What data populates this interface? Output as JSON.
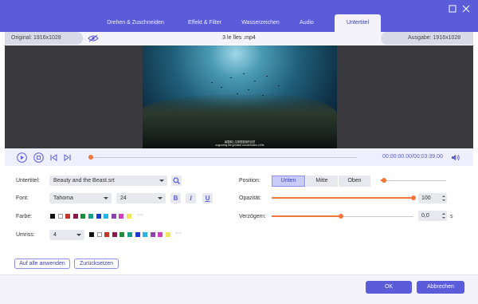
{
  "tabs": [
    "Drehen & Zuschneiden",
    "Effekt & Filter",
    "Wasserzeichen",
    "Audio",
    "Untertitel"
  ],
  "active_tab": "Untertitel",
  "info": {
    "original": "Original: 1916x1028",
    "filename": "3 le îles .mp4",
    "output": "Ausgabe: 1916x1028"
  },
  "video": {
    "subtitle_line1": "暴雪脚上生物很震撼的自然",
    "subtitle_line2": "supporting the greatest concentration of life"
  },
  "player": {
    "time": "00:00:00.00/00:03:39.00",
    "progress": 0.0
  },
  "form": {
    "subtitle_label": "Untertitel:",
    "subtitle_file": "Beauty and the Beast.srt",
    "font_label": "Font:",
    "font_name": "Tahoma",
    "font_size": "24",
    "bold": "B",
    "italic": "I",
    "underline": "U",
    "color_label": "Farbe:",
    "outline_label": "Umriss:",
    "outline_value": "4",
    "more": "···"
  },
  "swatches": [
    "#111111",
    "#ffffff",
    "#c0392b",
    "#8b1a4a",
    "#1e8a3c",
    "#16a085",
    "#2038c9",
    "#27b3e6",
    "#8e44ad",
    "#d03fbf",
    "#f1e35b"
  ],
  "position": {
    "label": "Position:",
    "options": [
      "Unten",
      "Mitte",
      "Oben"
    ],
    "selected": "Unten",
    "slider": 0.05
  },
  "opacity": {
    "label": "Opazität:",
    "value": "100",
    "level": 1.0
  },
  "delay": {
    "label": "Verzögern:",
    "value": "0,0",
    "unit": "s",
    "level": 0.49
  },
  "actions": {
    "apply_all": "Auf alle anwenden",
    "reset": "Zurücksetzen",
    "ok": "OK",
    "cancel": "Abbrechen"
  },
  "colors": {
    "accent": "#5b5cd9",
    "slider": "#f0763a"
  }
}
